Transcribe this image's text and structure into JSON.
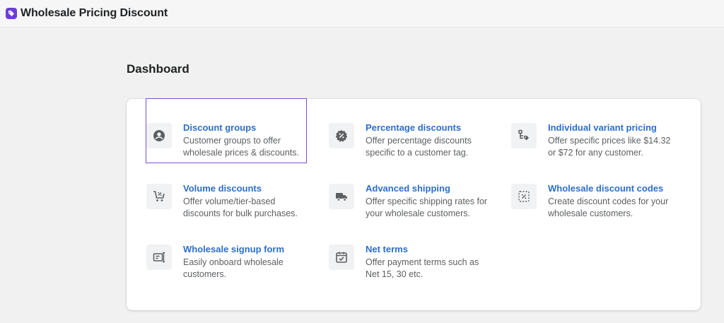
{
  "header": {
    "app_title": "Wholesale Pricing Discount",
    "logo_icon": "tag-icon",
    "logo_color": "#6b3fd4"
  },
  "page": {
    "title": "Dashboard"
  },
  "features": [
    {
      "title": "Discount groups",
      "description": "Customer groups to offer wholesale prices & discounts.",
      "icon": "customer-icon",
      "selected": true
    },
    {
      "title": "Percentage discounts",
      "description": "Offer percentage discounts specific to a customer tag.",
      "icon": "discount-badge-icon"
    },
    {
      "title": "Individual variant pricing",
      "description": "Offer specific prices like $14.32 or $72 for any customer.",
      "icon": "variant-tag-icon"
    },
    {
      "title": "Volume discounts",
      "description": "Offer volume/tier-based discounts for bulk purchases.",
      "icon": "cart-discount-icon"
    },
    {
      "title": "Advanced shipping",
      "description": "Offer specific shipping rates for your wholesale customers.",
      "icon": "truck-icon"
    },
    {
      "title": "Wholesale discount codes",
      "description": "Create discount codes for your wholesale customers.",
      "icon": "discount-code-icon"
    },
    {
      "title": "Wholesale signup form",
      "description": "Easily onboard wholesale customers.",
      "icon": "form-icon"
    },
    {
      "title": "Net terms",
      "description": "Offer payment terms such as Net 15, 30 etc.",
      "icon": "calendar-check-icon"
    }
  ],
  "colors": {
    "link": "#2c6ecb",
    "selection_outline": "#7b50d6",
    "icon": "#5c5f62"
  }
}
